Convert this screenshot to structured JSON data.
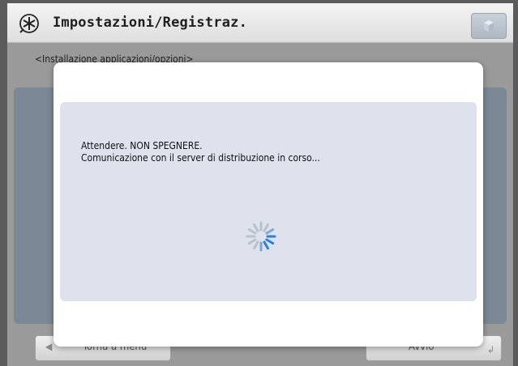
{
  "header": {
    "title": "Impostazioni/Registraz.",
    "app_icon": "settings-asterisk-icon",
    "corner_icon": "cube-icon"
  },
  "subtitle": "<Installazione applicazioni/opzioni>",
  "footer": {
    "back_label": "Torna a menu",
    "back_icon": "left-arrow-icon",
    "start_label": "Avvio",
    "start_icon": "enter-icon"
  },
  "dialog": {
    "line1": "Attendere. NON SPEGNERE.",
    "line2": "Comunicazione con il server di distribuzione in corso...",
    "busy_icon": "loading-spinner-icon"
  },
  "colors": {
    "accent": "#2f7fd4",
    "panel": "#dde2ec"
  }
}
